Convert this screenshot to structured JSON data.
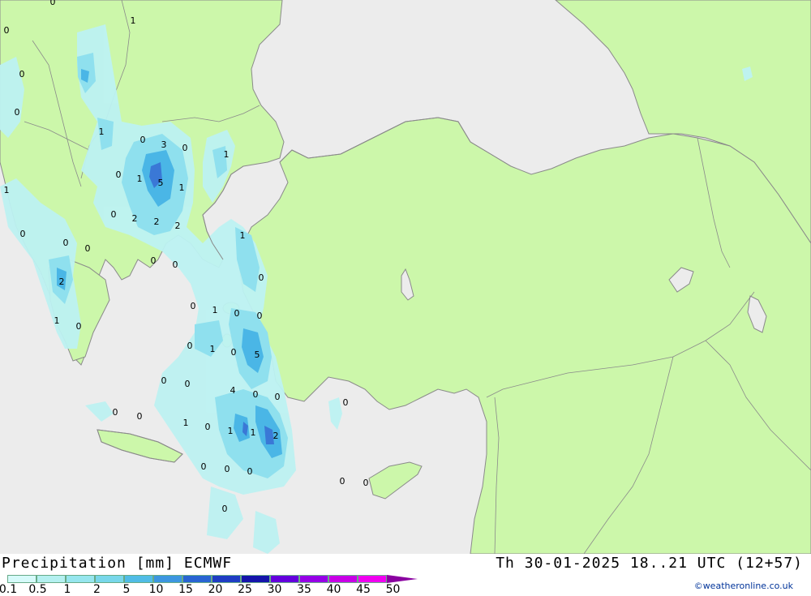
{
  "title": "Precipitation [mm] ECMWF",
  "valid_time": "Th 30-01-2025 18..21 UTC (12+57)",
  "credit": "©weatheronline.co.uk",
  "colors": {
    "sea": "#ececec",
    "land": "#ccf7aa",
    "border": "#8a8a8a",
    "rain_light": "#bdf2f2",
    "rain_mid": "#8fe0ee",
    "rain_heavy": "#4ab6e6",
    "rain_core": "#3a78d6"
  },
  "legend": {
    "labels": [
      "0.1",
      "0.5",
      "1",
      "2",
      "5",
      "10",
      "15",
      "20",
      "25",
      "30",
      "35",
      "40",
      "45",
      "50"
    ],
    "colors": [
      "#d6fafa",
      "#b4f0f0",
      "#96e6ee",
      "#78d7ea",
      "#50bce6",
      "#3c96e0",
      "#2864d2",
      "#1e3cc3",
      "#1414aa",
      "#6400dc",
      "#9600e6",
      "#c800e6",
      "#f000f0",
      "#c800c8"
    ]
  },
  "map_labels": [
    "0",
    "1",
    "0",
    "0",
    "0",
    "1",
    "0",
    "3",
    "0",
    "1",
    "0",
    "1",
    "5",
    "1",
    "1",
    "0",
    "2",
    "2",
    "2",
    "0",
    "0",
    "0",
    "1",
    "0",
    "0",
    "2",
    "1",
    "0",
    "0",
    "0",
    "1",
    "0",
    "0",
    "1",
    "0",
    "5",
    "0",
    "0",
    "4",
    "0",
    "0",
    "0",
    "0",
    "0",
    "1",
    "1",
    "2",
    "0",
    "1",
    "0",
    "0",
    "0",
    "0",
    "0",
    "0",
    "0"
  ]
}
